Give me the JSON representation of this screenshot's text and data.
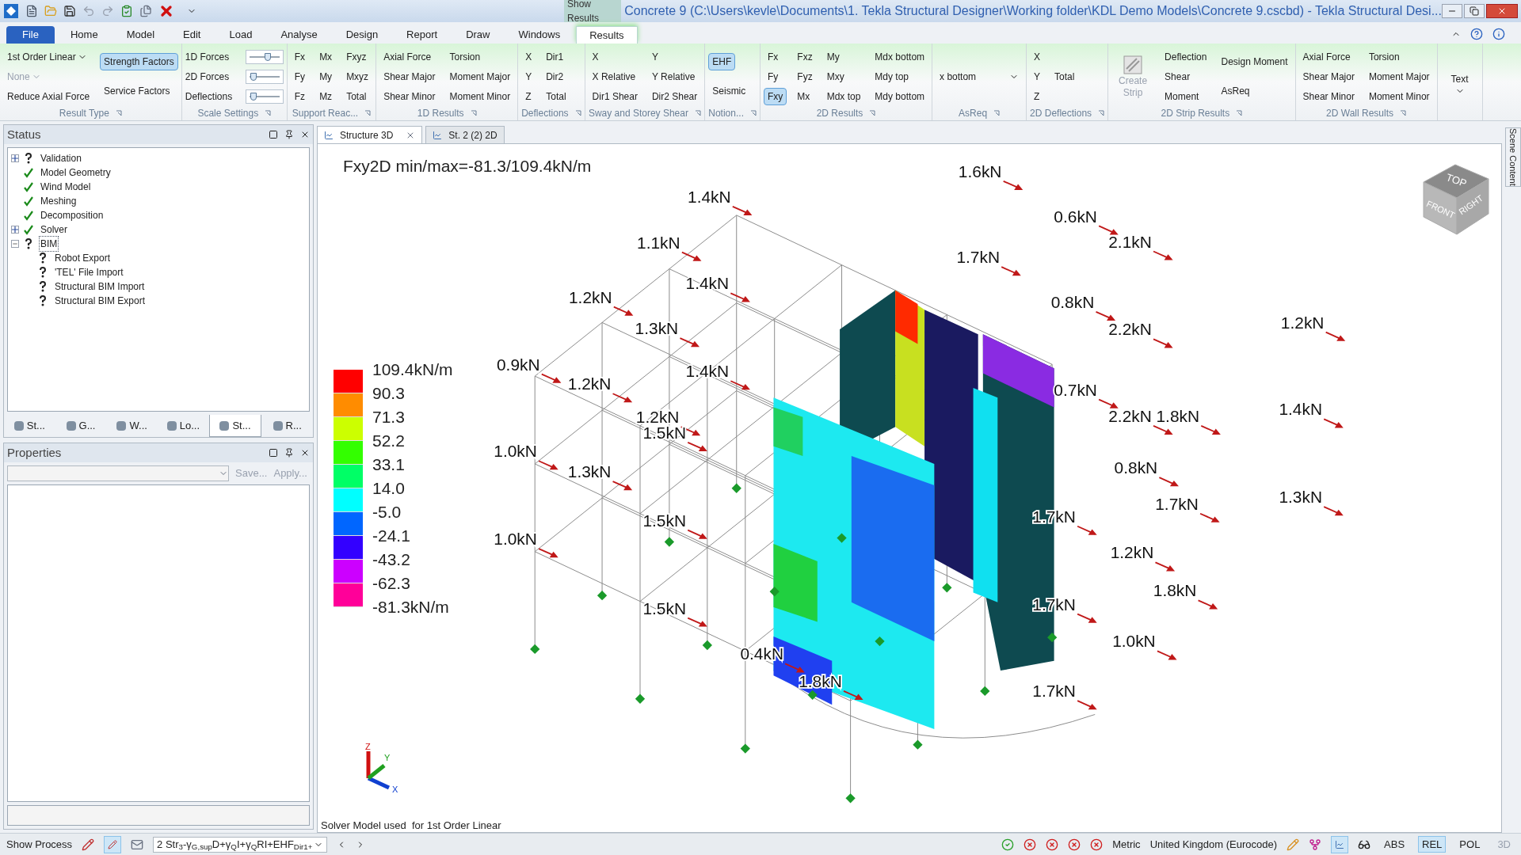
{
  "window": {
    "title": "Concrete 9 (C:\\Users\\kevle\\Documents\\1. Tekla Structural Designer\\Working folder\\KDL Demo Models\\Concrete 9.cscbd) - Tekla Structural Desi...",
    "context_tab": "Show Results"
  },
  "menu_tabs": [
    {
      "label": "File",
      "kind": "file",
      "selected": false
    },
    {
      "label": "Home",
      "kind": "tab",
      "selected": false
    },
    {
      "label": "Model",
      "kind": "tab",
      "selected": false
    },
    {
      "label": "Edit",
      "kind": "tab",
      "selected": false
    },
    {
      "label": "Load",
      "kind": "tab",
      "selected": false
    },
    {
      "label": "Analyse",
      "kind": "tab",
      "selected": false
    },
    {
      "label": "Design",
      "kind": "tab",
      "selected": false
    },
    {
      "label": "Report",
      "kind": "tab",
      "selected": false
    },
    {
      "label": "Draw",
      "kind": "tab",
      "selected": false
    },
    {
      "label": "Windows",
      "kind": "tab",
      "selected": false
    },
    {
      "label": "Results",
      "kind": "tab",
      "selected": true
    }
  ],
  "ribbon": {
    "groups": [
      {
        "label": "Result Type",
        "columns": [
          [
            {
              "label": "1st Order Linear",
              "kind": "dropdown",
              "selected": false,
              "disabled": false
            },
            {
              "label": "None",
              "kind": "dropdown",
              "selected": false,
              "disabled": true
            },
            {
              "label": "Reduce Axial Force",
              "kind": "button",
              "selected": false,
              "disabled": false
            }
          ],
          [
            {
              "label": "Strength Factors",
              "kind": "button",
              "selected": true,
              "disabled": false
            },
            {
              "label": "Service Factors",
              "kind": "button",
              "selected": false,
              "disabled": false
            }
          ]
        ]
      },
      {
        "label": "Scale Settings",
        "columns": [
          [
            {
              "label": "1D Forces",
              "kind": "slider",
              "level": 0.6
            },
            {
              "label": "2D Forces",
              "kind": "slider",
              "level": 0.2
            },
            {
              "label": "Deflections",
              "kind": "slider",
              "level": 0.2
            }
          ]
        ]
      },
      {
        "label": "Support Reac...",
        "columns": [
          [
            {
              "label": "Fx",
              "kind": "button",
              "selected": false,
              "disabled": false
            },
            {
              "label": "Fy",
              "kind": "button",
              "selected": false,
              "disabled": false
            },
            {
              "label": "Fz",
              "kind": "button",
              "selected": false,
              "disabled": false
            }
          ],
          [
            {
              "label": "Mx",
              "kind": "button",
              "selected": false,
              "disabled": false
            },
            {
              "label": "My",
              "kind": "button",
              "selected": false,
              "disabled": false
            },
            {
              "label": "Mz",
              "kind": "button",
              "selected": false,
              "disabled": false
            }
          ],
          [
            {
              "label": "Fxyz",
              "kind": "button",
              "selected": false,
              "disabled": false
            },
            {
              "label": "Mxyz",
              "kind": "button",
              "selected": false,
              "disabled": false
            },
            {
              "label": "Total",
              "kind": "button",
              "selected": false,
              "disabled": false
            }
          ]
        ]
      },
      {
        "label": "1D Results",
        "columns": [
          [
            {
              "label": "Axial Force",
              "kind": "button",
              "selected": false,
              "disabled": false
            },
            {
              "label": "Shear Major",
              "kind": "button",
              "selected": false,
              "disabled": false
            },
            {
              "label": "Shear Minor",
              "kind": "button",
              "selected": false,
              "disabled": false
            }
          ],
          [
            {
              "label": "Torsion",
              "kind": "button",
              "selected": false,
              "disabled": false
            },
            {
              "label": "Moment Major",
              "kind": "button",
              "selected": false,
              "disabled": false
            },
            {
              "label": "Moment Minor",
              "kind": "button",
              "selected": false,
              "disabled": false
            }
          ]
        ]
      },
      {
        "label": "Deflections",
        "columns": [
          [
            {
              "label": "X",
              "kind": "button",
              "selected": false,
              "disabled": false
            },
            {
              "label": "Y",
              "kind": "button",
              "selected": false,
              "disabled": false
            },
            {
              "label": "Z",
              "kind": "button",
              "selected": false,
              "disabled": false
            }
          ],
          [
            {
              "label": "Dir1",
              "kind": "button",
              "selected": false,
              "disabled": false
            },
            {
              "label": "Dir2",
              "kind": "button",
              "selected": false,
              "disabled": false
            },
            {
              "label": "Total",
              "kind": "button",
              "selected": false,
              "disabled": false
            }
          ]
        ]
      },
      {
        "label": "Sway and Storey Shear",
        "columns": [
          [
            {
              "label": "X",
              "kind": "button",
              "selected": false,
              "disabled": false
            },
            {
              "label": "X Relative",
              "kind": "button",
              "selected": false,
              "disabled": false
            },
            {
              "label": "Dir1 Shear",
              "kind": "button",
              "selected": false,
              "disabled": false
            }
          ],
          [
            {
              "label": "Y",
              "kind": "button",
              "selected": false,
              "disabled": false
            },
            {
              "label": "Y Relative",
              "kind": "button",
              "selected": false,
              "disabled": false
            },
            {
              "label": "Dir2 Shear",
              "kind": "button",
              "selected": false,
              "disabled": false
            }
          ]
        ]
      },
      {
        "label": "Notion...",
        "columns": [
          [
            {
              "label": "EHF",
              "kind": "button",
              "selected": true,
              "disabled": false
            },
            {
              "label": "Seismic",
              "kind": "button",
              "selected": false,
              "disabled": false
            }
          ]
        ]
      },
      {
        "label": "2D Results",
        "columns": [
          [
            {
              "label": "Fx",
              "kind": "button",
              "selected": false,
              "disabled": false
            },
            {
              "label": "Fy",
              "kind": "button",
              "selected": false,
              "disabled": false
            },
            {
              "label": "Fxy",
              "kind": "button",
              "selected": true,
              "disabled": false
            }
          ],
          [
            {
              "label": "Fxz",
              "kind": "button",
              "selected": false,
              "disabled": false
            },
            {
              "label": "Fyz",
              "kind": "button",
              "selected": false,
              "disabled": false
            },
            {
              "label": "Mx",
              "kind": "button",
              "selected": false,
              "disabled": false
            }
          ],
          [
            {
              "label": "My",
              "kind": "button",
              "selected": false,
              "disabled": false
            },
            {
              "label": "Mxy",
              "kind": "button",
              "selected": false,
              "disabled": false
            },
            {
              "label": "Mdx top",
              "kind": "button",
              "selected": false,
              "disabled": false
            }
          ],
          [
            {
              "label": "Mdx bottom",
              "kind": "button",
              "selected": false,
              "disabled": false
            },
            {
              "label": "Mdy top",
              "kind": "button",
              "selected": false,
              "disabled": false
            },
            {
              "label": "Mdy bottom",
              "kind": "button",
              "selected": false,
              "disabled": false
            }
          ]
        ]
      },
      {
        "label": "AsReq",
        "columns": [
          [
            {
              "label": "x bottom",
              "kind": "combo",
              "selected": false,
              "disabled": false
            }
          ]
        ]
      },
      {
        "label": "2D Deflections",
        "columns": [
          [
            {
              "label": "X",
              "kind": "button",
              "selected": false,
              "disabled": false
            },
            {
              "label": "Y",
              "kind": "button",
              "selected": false,
              "disabled": false
            },
            {
              "label": "Z",
              "kind": "button",
              "selected": false,
              "disabled": false
            }
          ],
          [
            {
              "label": "Total",
              "kind": "button",
              "selected": false,
              "disabled": false
            }
          ]
        ]
      },
      {
        "label": "2D Strip Results",
        "columns": [
          [
            {
              "label": "Create Strip",
              "kind": "large",
              "selected": false,
              "disabled": true
            }
          ],
          [
            {
              "label": "Deflection",
              "kind": "button",
              "selected": false,
              "disabled": false
            },
            {
              "label": "Shear",
              "kind": "button",
              "selected": false,
              "disabled": false
            },
            {
              "label": "Moment",
              "kind": "button",
              "selected": false,
              "disabled": false
            }
          ],
          [
            {
              "label": "Design Moment",
              "kind": "button",
              "selected": false,
              "disabled": false
            },
            {
              "label": "AsReq",
              "kind": "button",
              "selected": false,
              "disabled": false
            }
          ]
        ]
      },
      {
        "label": "2D Wall Results",
        "columns": [
          [
            {
              "label": "Axial Force",
              "kind": "button",
              "selected": false,
              "disabled": false
            },
            {
              "label": "Shear Major",
              "kind": "button",
              "selected": false,
              "disabled": false
            },
            {
              "label": "Shear Minor",
              "kind": "button",
              "selected": false,
              "disabled": false
            }
          ],
          [
            {
              "label": "Torsion",
              "kind": "button",
              "selected": false,
              "disabled": false
            },
            {
              "label": "Moment Major",
              "kind": "button",
              "selected": false,
              "disabled": false
            },
            {
              "label": "Moment Minor",
              "kind": "button",
              "selected": false,
              "disabled": false
            }
          ]
        ]
      },
      {
        "columns": [
          [
            {
              "label": "Text",
              "kind": "largedrop",
              "selected": false,
              "disabled": false
            }
          ]
        ]
      }
    ]
  },
  "status_panel": {
    "title": "Status",
    "tree": [
      {
        "label": "Validation",
        "kind": "unknown",
        "expanded": false,
        "selected": false
      },
      {
        "label": "Model Geometry",
        "kind": "ok",
        "selected": false
      },
      {
        "label": "Wind Model",
        "kind": "ok",
        "selected": false
      },
      {
        "label": "Meshing",
        "kind": "ok",
        "selected": false
      },
      {
        "label": "Decomposition",
        "kind": "ok",
        "selected": false
      },
      {
        "label": "Solver",
        "kind": "ok",
        "expanded": false,
        "selected": false
      },
      {
        "label": "BIM",
        "kind": "unknown",
        "expanded": true,
        "selected": true,
        "children": [
          {
            "label": "Robot Export",
            "kind": "unknown",
            "selected": false
          },
          {
            "label": "'TEL' File Import",
            "kind": "unknown",
            "selected": false
          },
          {
            "label": "Structural BIM Import",
            "kind": "unknown",
            "selected": false
          },
          {
            "label": "Structural BIM Export",
            "kind": "unknown",
            "selected": false
          }
        ]
      }
    ],
    "tabs": [
      {
        "label": "St...",
        "selected": false
      },
      {
        "label": "G...",
        "selected": false
      },
      {
        "label": "W...",
        "selected": false
      },
      {
        "label": "Lo...",
        "selected": false
      },
      {
        "label": "St...",
        "selected": true
      },
      {
        "label": "R...",
        "selected": false
      }
    ]
  },
  "properties_panel": {
    "title": "Properties",
    "buttons": [
      {
        "label": "Save...",
        "disabled": true
      },
      {
        "label": "Apply...",
        "disabled": true
      }
    ]
  },
  "view_tabs": [
    {
      "label": "Structure 3D",
      "selected": true
    },
    {
      "label": "St. 2 (2) 2D",
      "selected": false
    }
  ],
  "viewport": {
    "title": "Fxy2D min/max=-81.3/109.4kN/m",
    "legend": {
      "labels": [
        "109.4kN/m",
        "90.3",
        "71.3",
        "52.2",
        "33.1",
        "14.0",
        "-5.0",
        "-24.1",
        "-43.2",
        "-62.3",
        "-81.3kN/m"
      ],
      "bands": [
        {
          "color": "#ff0000"
        },
        {
          "color": "#ff8c00"
        },
        {
          "color": "#ccff00"
        },
        {
          "color": "#33ff00"
        },
        {
          "color": "#00ff66"
        },
        {
          "color": "#00ffff"
        },
        {
          "color": "#0066ff"
        },
        {
          "color": "#3300ff"
        },
        {
          "color": "#cc00ff"
        },
        {
          "color": "#ff0099"
        }
      ]
    },
    "force_labels": [
      "1.6kN",
      "1.4kN",
      "0.6kN",
      "2.1kN",
      "1.1kN",
      "1.7kN",
      "1.4kN",
      "1.2kN",
      "0.8kN",
      "1.2kN",
      "1.3kN",
      "2.2kN",
      "0.9kN",
      "1.4kN",
      "1.2kN",
      "0.7kN",
      "1.2kN",
      "2.2kN",
      "1.8kN",
      "1.4kN",
      "1.5kN",
      "1.0kN",
      "1.3kN",
      "0.8kN",
      "1.3kN",
      "1.7kN",
      "1.7kN",
      "1.5kN",
      "1.0kN",
      "1.2kN",
      "1.8kN",
      "1.5kN",
      "1.7kN",
      "1.0kN",
      "0.4kN",
      "1.8kN",
      "1.7kN"
    ],
    "view_cube": {
      "top": "TOP",
      "front": "FRONT",
      "right": "RIGHT"
    },
    "axes": {
      "x": "X",
      "y": "Y",
      "z": "Z"
    },
    "footer": "Solver Model used  for 1st Order Linear",
    "side_tab": "Scene Content"
  },
  "status_bar": {
    "show_process": "Show Process",
    "combination": "2 Str$_{3}$-γ$_{G,sup}$D+γ$_{Q}$I+γ$_{Q}$RI+EHF$_{Dir1+}$",
    "units": "Metric",
    "code": "United Kingdom (Eurocode)",
    "modes": [
      {
        "label": "ABS",
        "selected": false,
        "disabled": false
      },
      {
        "label": "REL",
        "selected": true,
        "disabled": false
      },
      {
        "label": "POL",
        "selected": false,
        "disabled": false
      },
      {
        "label": "3D",
        "selected": false,
        "disabled": true
      }
    ]
  }
}
